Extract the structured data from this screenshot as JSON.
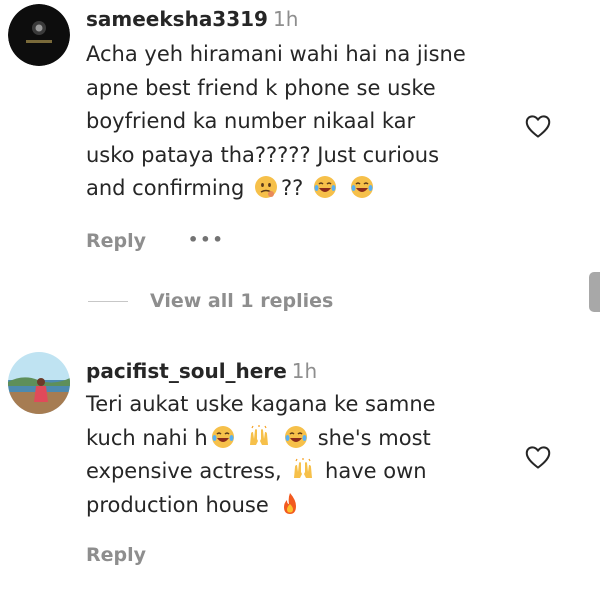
{
  "comments": [
    {
      "username": "sameeksha3319",
      "time": "1h",
      "lines": [
        "Acha yeh hiramani wahi hai na jisne",
        "apne best friend k phone se uske",
        "boyfriend ka number nikaal kar",
        "usko pataya tha????? Just curious",
        "and confirming"
      ],
      "line5_tail": "??",
      "reply_label": "Reply",
      "more_label": "•••",
      "emojis": [
        "thinking-face-emoji",
        "laughing-tears-emoji",
        "laughing-tears-emoji"
      ]
    },
    {
      "username": "pacifist_soul_here",
      "time": "1h",
      "line1": "Teri aukat uske kagana ke samne",
      "line2_a": "kuch nahi h",
      "line2_b": "she's most",
      "line3_a": "expensive actress,",
      "line3_b": "have own",
      "line4": "production house",
      "reply_label": "Reply",
      "emojis": [
        "laughing-tears-emoji",
        "raised-hands-emoji",
        "laughing-tears-emoji",
        "raised-hands-emoji",
        "fire-emoji"
      ]
    }
  ],
  "view_replies_label": "View all 1 replies",
  "colors": {
    "text": "#262626",
    "secondary": "#8e8e8e",
    "divider": "#c7c7c7"
  }
}
